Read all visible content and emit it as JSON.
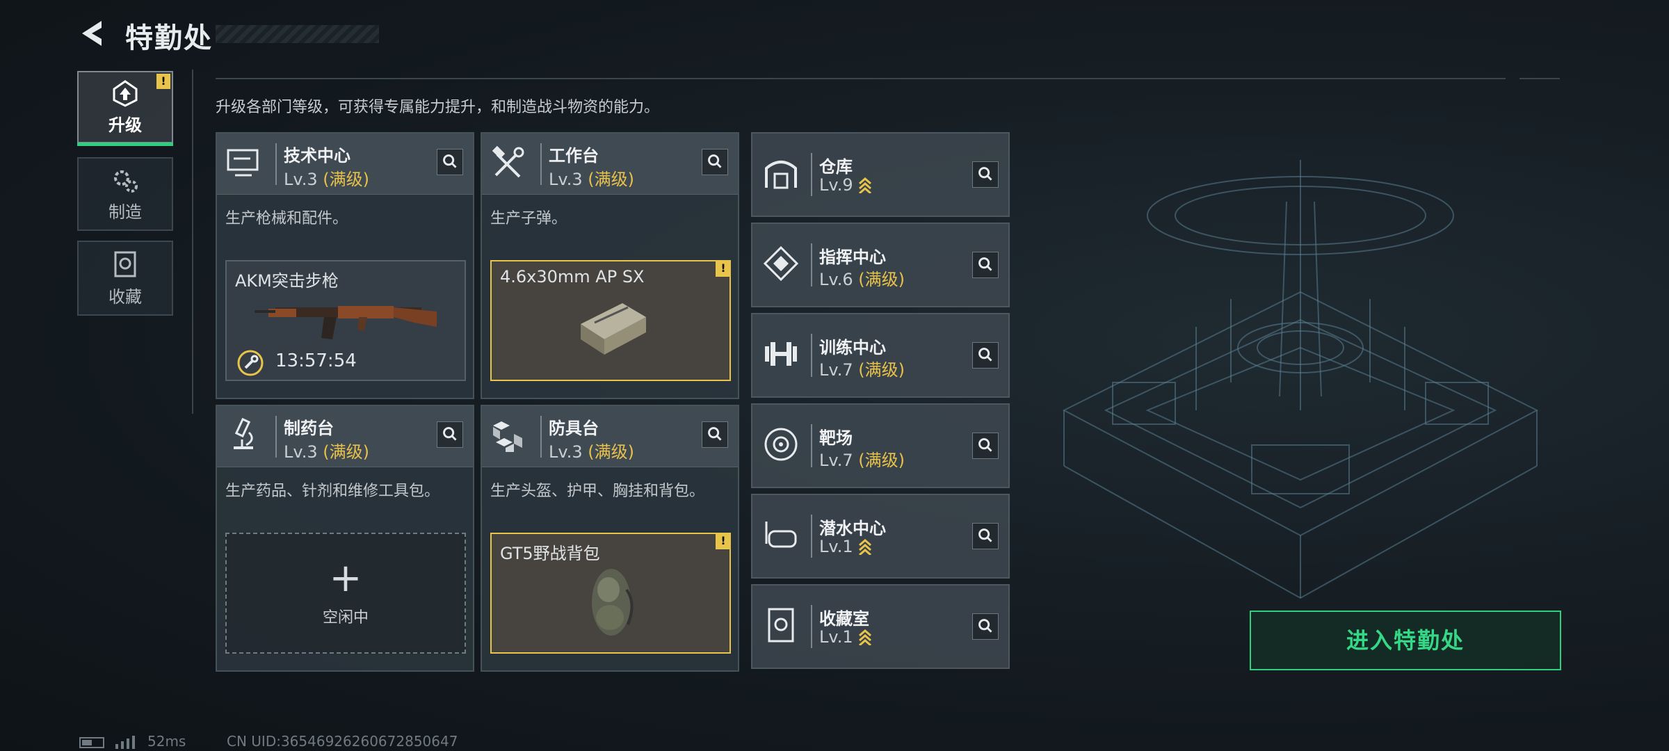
{
  "header": {
    "title": "特勤处"
  },
  "tabs": [
    {
      "label": "升级",
      "active": true,
      "badge": "!"
    },
    {
      "label": "制造",
      "active": false
    },
    {
      "label": "收藏",
      "active": false
    }
  ],
  "description": "升级各部门等级，可获得专属能力提升，和制造战斗物资的能力。",
  "cards": [
    {
      "name": "技术中心",
      "level": "Lv.3",
      "max": "(满级)",
      "desc": "生产枪械和配件。",
      "slot": {
        "name": "AKM突击步枪",
        "timer": "13:57:54"
      }
    },
    {
      "name": "工作台",
      "level": "Lv.3",
      "max": "(满级)",
      "desc": "生产子弹。",
      "slot": {
        "name": "4.6x30mm AP SX",
        "badge": "!"
      }
    },
    {
      "name": "制药台",
      "level": "Lv.3",
      "max": "(满级)",
      "desc": "生产药品、针剂和维修工具包。",
      "slot": {
        "plus": "+",
        "idle": "空闲中"
      }
    },
    {
      "name": "防具台",
      "level": "Lv.3",
      "max": "(满级)",
      "desc": "生产头盔、护甲、胸挂和背包。",
      "slot": {
        "name": "GT5野战背包",
        "badge": "!"
      }
    }
  ],
  "side_cards": [
    {
      "name": "仓库",
      "level": "Lv.9",
      "max": ""
    },
    {
      "name": "指挥中心",
      "level": "Lv.6",
      "max": "(满级)"
    },
    {
      "name": "训练中心",
      "level": "Lv.7",
      "max": "(满级)"
    },
    {
      "name": "靶场",
      "level": "Lv.7",
      "max": "(满级)"
    },
    {
      "name": "潜水中心",
      "level": "Lv.1",
      "max": ""
    },
    {
      "name": "收藏室",
      "level": "Lv.1",
      "max": ""
    }
  ],
  "enter_button": "进入特勤处",
  "status": {
    "ping": "52ms",
    "uid": "CN UID:36546926260672850647"
  },
  "colors": {
    "accent_green": "#2fcf7e",
    "gold": "#e9c44a"
  }
}
